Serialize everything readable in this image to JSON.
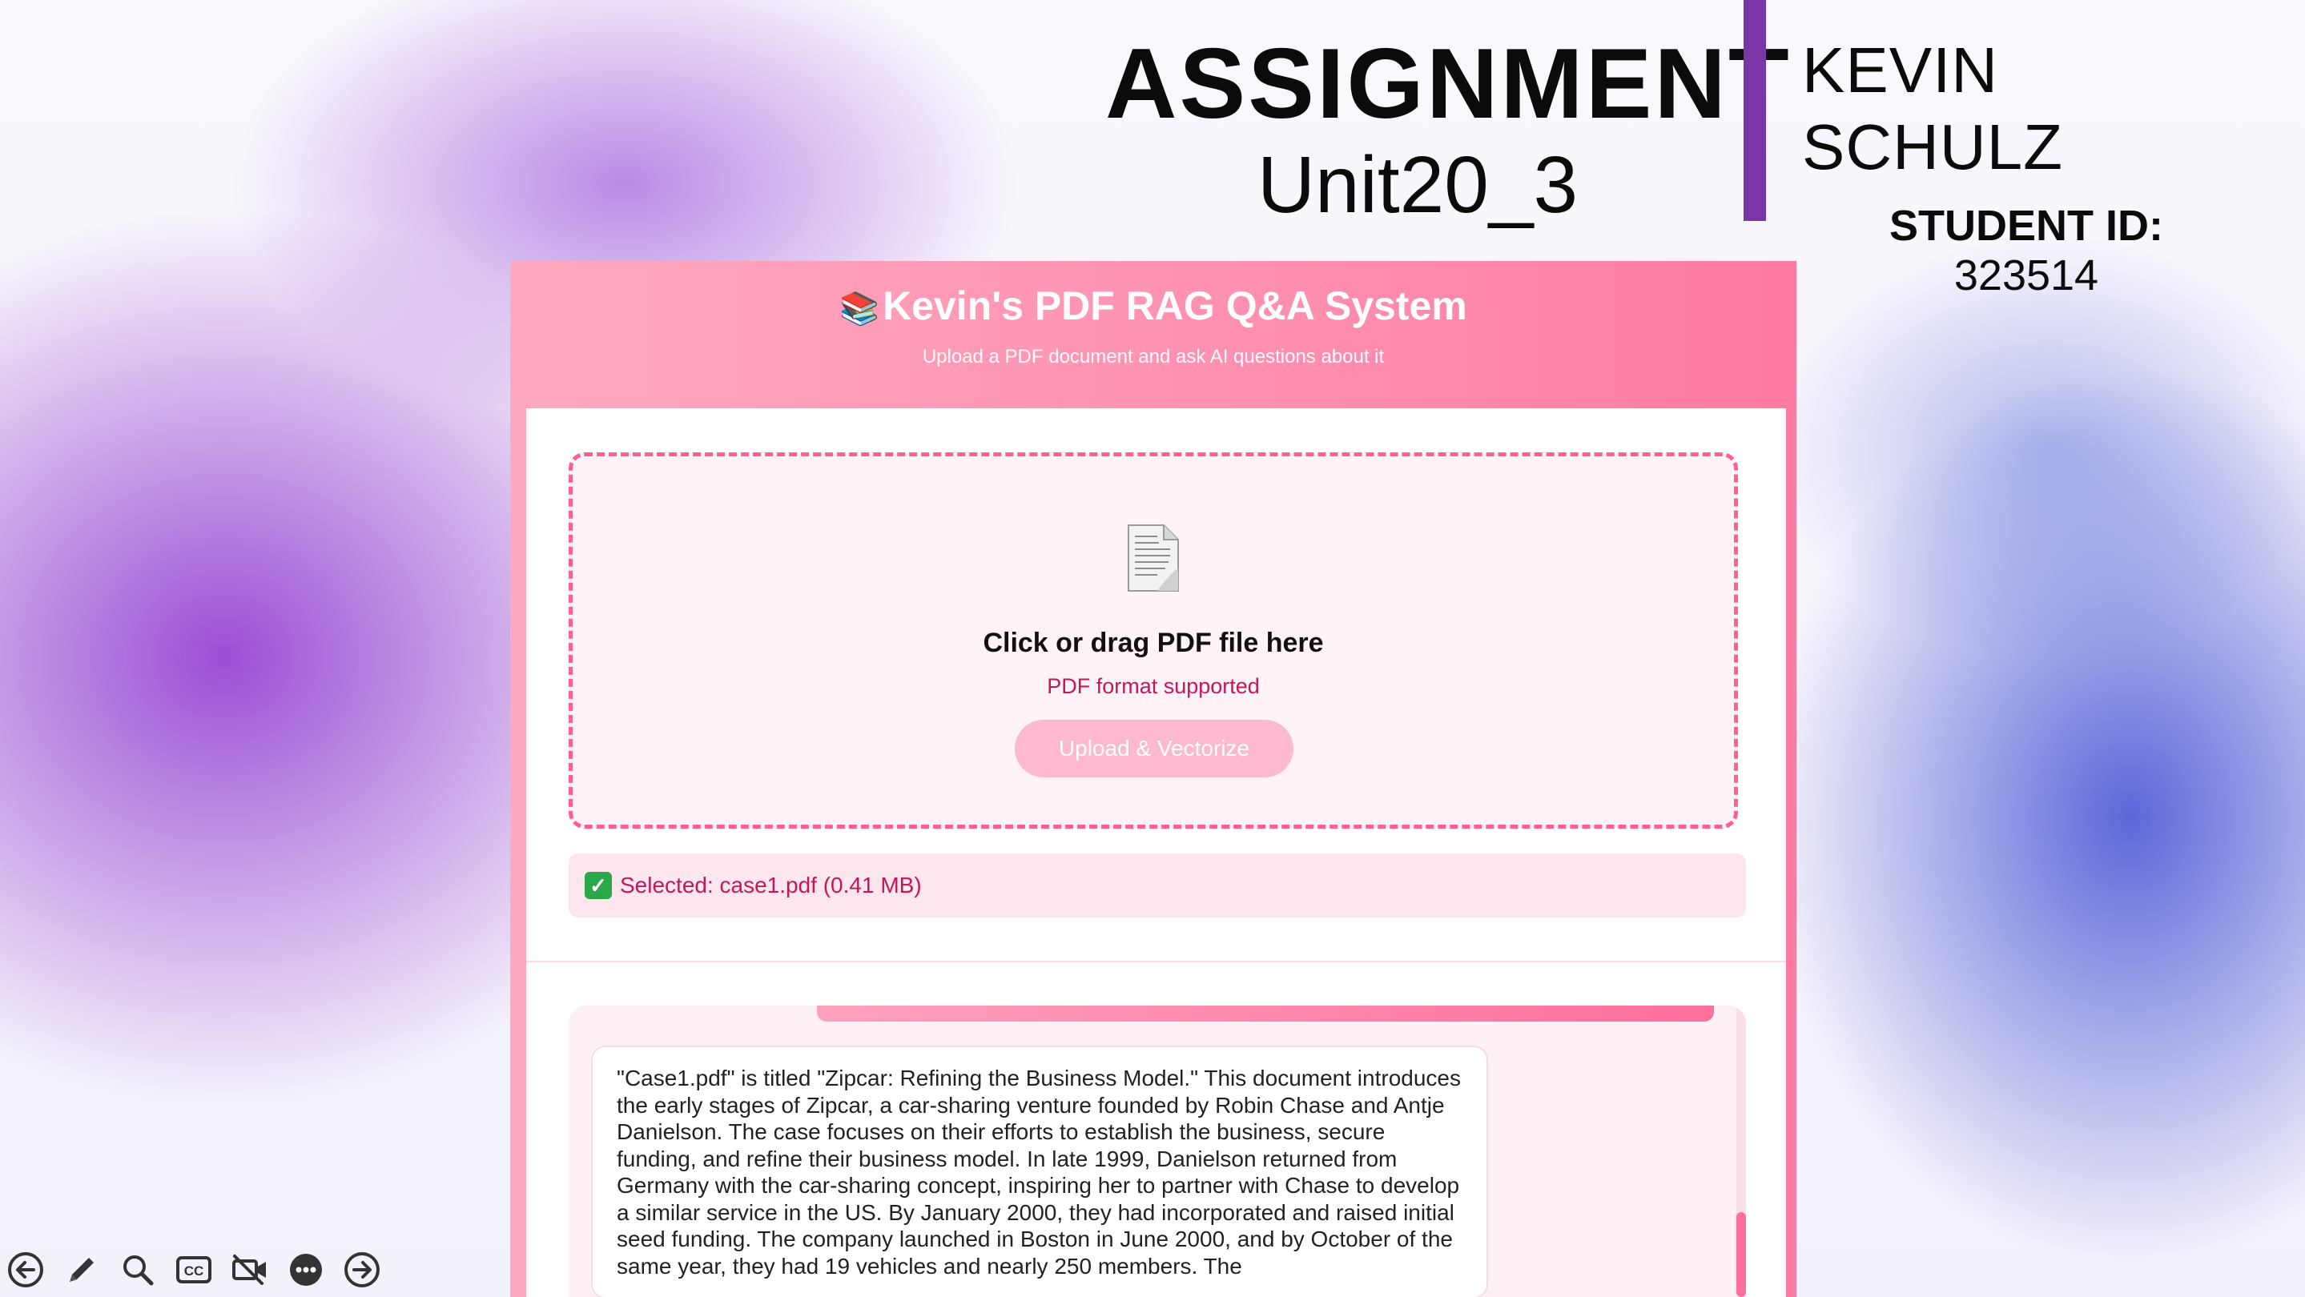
{
  "slide": {
    "title": "ASSIGNMENT",
    "subtitle": "Unit20_3",
    "student_name": "KEVIN SCHULZ",
    "student_id_label": "STUDENT ID:",
    "student_id": "323514",
    "accent_color": "#7a36a6"
  },
  "app": {
    "title": "Kevin's PDF RAG Q&A System",
    "title_icon": "books-icon",
    "subtitle": "Upload a PDF document and ask AI questions about it",
    "dropzone": {
      "icon": "document-icon",
      "title": "Click or drag PDF file here",
      "hint": "PDF format supported",
      "upload_label": "Upload & Vectorize"
    },
    "selected_file": "Selected: case1.pdf (0.41 MB)",
    "answer": "\"Case1.pdf\" is titled \"Zipcar: Refining the Business Model.\" This document introduces the early stages of Zipcar, a car-sharing venture founded by Robin Chase and Antje Danielson. The case focuses on their efforts to establish the business, secure funding, and refine their business model. In late 1999, Danielson returned from Germany with the car-sharing concept, inspiring her to partner with Chase to develop a similar service in the US. By January 2000, they had incorporated and raised initial seed funding. The company launched in Boston in June 2000, and by October of the same year, they had 19 vehicles and nearly 250 members. The",
    "colors": {
      "primary": "#ff6f9c",
      "accent_text": "#c2185b",
      "success": "#2ba84a"
    }
  },
  "toolbar": {
    "items": [
      "previous-slide-icon",
      "pen-icon",
      "zoom-icon",
      "captions-icon",
      "camera-off-icon",
      "more-options-icon",
      "next-slide-icon"
    ]
  }
}
